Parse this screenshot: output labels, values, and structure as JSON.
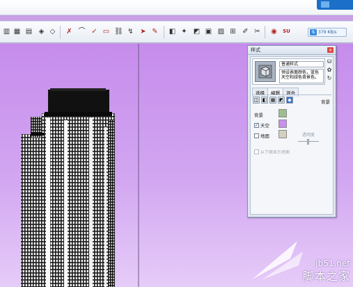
{
  "speed_indicator": {
    "value": "379 KB/s"
  },
  "toolbar": {
    "icons": [
      "walls-icon",
      "grid-icon",
      "stairs-icon",
      "layers-icon",
      "layers2-icon",
      "tool-icon",
      "curve-icon",
      "check-icon",
      "shape-icon",
      "link-icon",
      "bend-icon",
      "arrow-icon",
      "paint-icon",
      "select-icon",
      "tool2-icon",
      "box-icon",
      "grid-box-icon",
      "image-icon",
      "pen-icon",
      "pencil-icon",
      "plugin-icon",
      "su-icon"
    ]
  },
  "styles_panel": {
    "title": "样式",
    "style_name": "普通样式",
    "style_description": "预设表面颜色，蓝色天空和绿色背景色。",
    "tabs": [
      "选择",
      "编辑",
      "混合"
    ],
    "active_tab": "编辑",
    "section_title": "背景",
    "background_label": "背景",
    "sky_label": "天空",
    "sky_checked": true,
    "ground_label": "地面",
    "ground_checked": false,
    "opacity_label": "透明度",
    "show_ground_underside_label": "从下面显示地面",
    "colors": {
      "background": "#9cbf8f",
      "sky": "#c98ef0",
      "ground": "#d6d0bf"
    }
  },
  "watermark": {
    "site": "jb51.net",
    "brand": "脚本之家"
  }
}
